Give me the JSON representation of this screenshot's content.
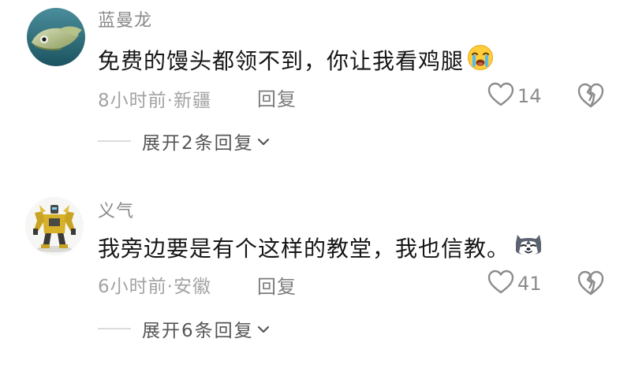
{
  "comments": [
    {
      "username": "蓝曼龙",
      "text": "免费的馒头都领不到，你让我看鸡腿",
      "emoji": "crying-face-emoji",
      "time_location": "8小时前·新疆",
      "reply_label": "回复",
      "like_count": "14",
      "expand_label": "展开2条回复"
    },
    {
      "username": "义气",
      "text": "我旁边要是有个这样的教堂，我也信教。",
      "emoji": "husky-dog-emoji",
      "time_location": "6小时前·安徽",
      "reply_label": "回复",
      "like_count": "41",
      "expand_label": "展开6条回复"
    }
  ]
}
